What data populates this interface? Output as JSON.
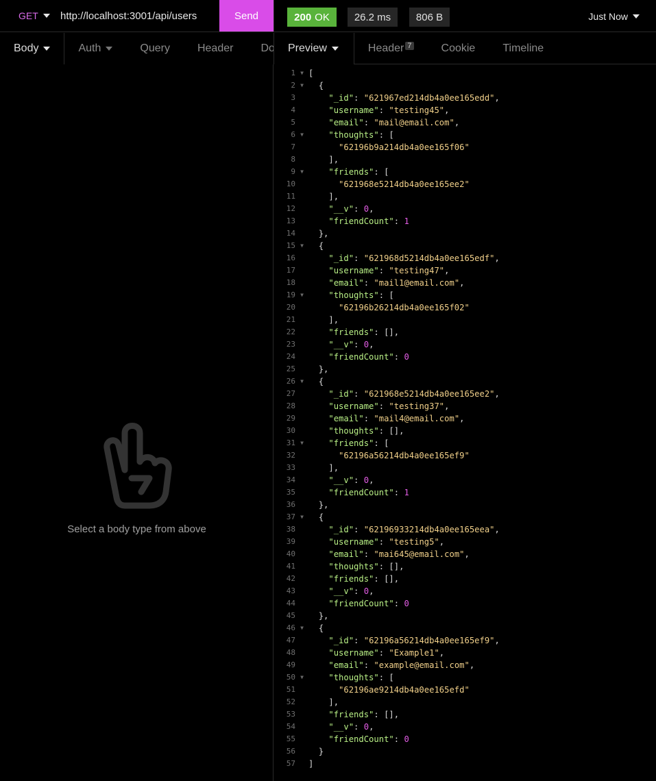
{
  "request": {
    "method": "GET",
    "url": "http://localhost:3001/api/users",
    "send_label": "Send"
  },
  "response_meta": {
    "status_code": "200",
    "status_text": "OK",
    "time": "26.2 ms",
    "size": "806 B",
    "history": "Just Now"
  },
  "request_tabs": [
    "Body",
    "Auth",
    "Query",
    "Header",
    "Docs"
  ],
  "response_tabs": [
    {
      "label": "Preview"
    },
    {
      "label": "Header",
      "badge": "7"
    },
    {
      "label": "Cookie"
    },
    {
      "label": "Timeline"
    }
  ],
  "body_empty_text": "Select a body type from above",
  "colors": {
    "send": "#d94ce8",
    "status_ok": "#59b33b",
    "method": "#d96bea",
    "json_key": "#b9f086",
    "json_string": "#f1d08a",
    "json_number": "#e45ee6"
  },
  "response_json": [
    {
      "_id": "621967ed214db4a0ee165edd",
      "username": "testing45",
      "email": "mail@email.com",
      "thoughts": [
        "62196b9a214db4a0ee165f06"
      ],
      "friends": [
        "621968e5214db4a0ee165ee2"
      ],
      "__v": 0,
      "friendCount": 1
    },
    {
      "_id": "621968d5214db4a0ee165edf",
      "username": "testing47",
      "email": "mail1@email.com",
      "thoughts": [
        "62196b26214db4a0ee165f02"
      ],
      "friends": [],
      "__v": 0,
      "friendCount": 0
    },
    {
      "_id": "621968e5214db4a0ee165ee2",
      "username": "testing37",
      "email": "mail4@email.com",
      "thoughts": [],
      "friends": [
        "62196a56214db4a0ee165ef9"
      ],
      "__v": 0,
      "friendCount": 1
    },
    {
      "_id": "62196933214db4a0ee165eea",
      "username": "testing5",
      "email": "mai645@email.com",
      "thoughts": [],
      "friends": [],
      "__v": 0,
      "friendCount": 0
    },
    {
      "_id": "62196a56214db4a0ee165ef9",
      "username": "Example1",
      "email": "example@email.com",
      "thoughts": [
        "62196ae9214db4a0ee165efd"
      ],
      "friends": [],
      "__v": 0,
      "friendCount": 0
    }
  ]
}
